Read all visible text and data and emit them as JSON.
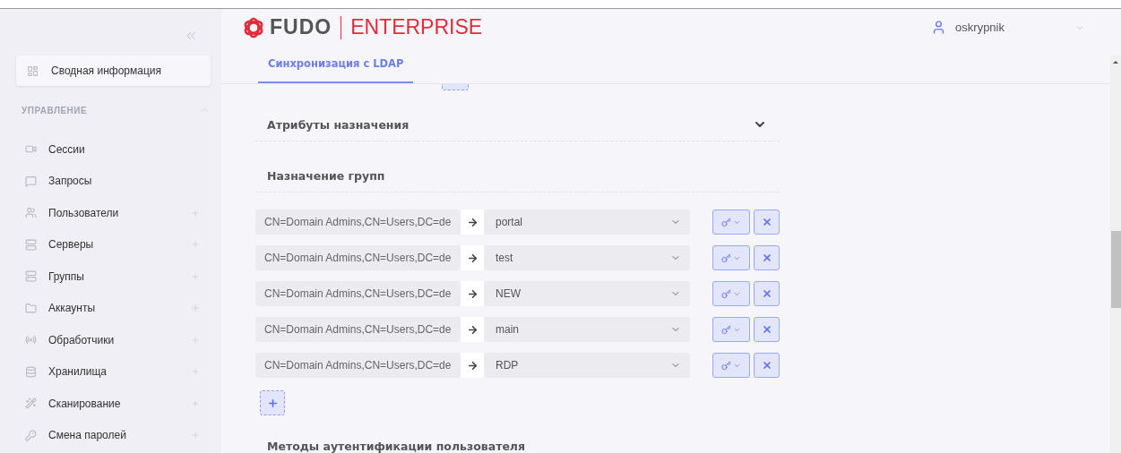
{
  "sidebar": {
    "summary": {
      "label": "Сводная информация",
      "selected": true
    },
    "section": {
      "title": "УПРАВЛЕНИЕ",
      "expanded": true
    },
    "items": [
      {
        "label": "Сессии",
        "kind": "sessions",
        "expandable": false
      },
      {
        "label": "Запросы",
        "kind": "requests",
        "expandable": false
      },
      {
        "label": "Пользователи",
        "kind": "users",
        "expandable": true
      },
      {
        "label": "Серверы",
        "kind": "servers",
        "expandable": true
      },
      {
        "label": "Группы",
        "kind": "groups",
        "expandable": true
      },
      {
        "label": "Аккаунты",
        "kind": "accounts",
        "expandable": true
      },
      {
        "label": "Обработчики",
        "kind": "listeners",
        "expandable": true
      },
      {
        "label": "Хранилища",
        "kind": "storage",
        "expandable": true
      },
      {
        "label": "Сканирование",
        "kind": "scan",
        "expandable": true
      },
      {
        "label": "Смена паролей",
        "kind": "passwords",
        "expandable": true
      }
    ]
  },
  "header": {
    "brand": "FUDO",
    "product": "ENTERPRISE",
    "user": "oskrypnik"
  },
  "tabs": [
    {
      "label": "Синхронизация с LDAP",
      "selected": true
    }
  ],
  "sections": [
    {
      "title": "Атрибуты назначения",
      "expanded": false
    }
  ],
  "group_mapping": {
    "title": "Назначение групп",
    "rows": [
      {
        "dn": "CN=Domain Admins,CN=Users,DC=de",
        "group": "portal"
      },
      {
        "dn": "CN=Domain Admins,CN=Users,DC=de",
        "group": "test"
      },
      {
        "dn": "CN=Domain Admins,CN=Users,DC=de",
        "group": "NEW"
      },
      {
        "dn": "CN=Domain Admins,CN=Users,DC=de",
        "group": "main"
      },
      {
        "dn": "CN=Domain Admins,CN=Users,DC=de",
        "group": "RDP"
      }
    ]
  },
  "next_section": {
    "title": "Методы аутентификации пользователя"
  }
}
